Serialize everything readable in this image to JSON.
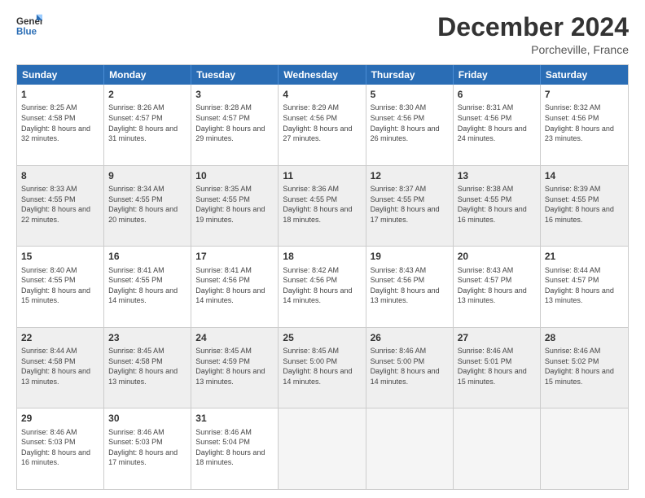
{
  "logo": {
    "line1": "General",
    "line2": "Blue"
  },
  "title": "December 2024",
  "subtitle": "Porcheville, France",
  "header_days": [
    "Sunday",
    "Monday",
    "Tuesday",
    "Wednesday",
    "Thursday",
    "Friday",
    "Saturday"
  ],
  "weeks": [
    {
      "shaded": false,
      "days": [
        {
          "num": "1",
          "sunrise": "Sunrise: 8:25 AM",
          "sunset": "Sunset: 4:58 PM",
          "daylight": "Daylight: 8 hours and 32 minutes."
        },
        {
          "num": "2",
          "sunrise": "Sunrise: 8:26 AM",
          "sunset": "Sunset: 4:57 PM",
          "daylight": "Daylight: 8 hours and 31 minutes."
        },
        {
          "num": "3",
          "sunrise": "Sunrise: 8:28 AM",
          "sunset": "Sunset: 4:57 PM",
          "daylight": "Daylight: 8 hours and 29 minutes."
        },
        {
          "num": "4",
          "sunrise": "Sunrise: 8:29 AM",
          "sunset": "Sunset: 4:56 PM",
          "daylight": "Daylight: 8 hours and 27 minutes."
        },
        {
          "num": "5",
          "sunrise": "Sunrise: 8:30 AM",
          "sunset": "Sunset: 4:56 PM",
          "daylight": "Daylight: 8 hours and 26 minutes."
        },
        {
          "num": "6",
          "sunrise": "Sunrise: 8:31 AM",
          "sunset": "Sunset: 4:56 PM",
          "daylight": "Daylight: 8 hours and 24 minutes."
        },
        {
          "num": "7",
          "sunrise": "Sunrise: 8:32 AM",
          "sunset": "Sunset: 4:56 PM",
          "daylight": "Daylight: 8 hours and 23 minutes."
        }
      ]
    },
    {
      "shaded": true,
      "days": [
        {
          "num": "8",
          "sunrise": "Sunrise: 8:33 AM",
          "sunset": "Sunset: 4:55 PM",
          "daylight": "Daylight: 8 hours and 22 minutes."
        },
        {
          "num": "9",
          "sunrise": "Sunrise: 8:34 AM",
          "sunset": "Sunset: 4:55 PM",
          "daylight": "Daylight: 8 hours and 20 minutes."
        },
        {
          "num": "10",
          "sunrise": "Sunrise: 8:35 AM",
          "sunset": "Sunset: 4:55 PM",
          "daylight": "Daylight: 8 hours and 19 minutes."
        },
        {
          "num": "11",
          "sunrise": "Sunrise: 8:36 AM",
          "sunset": "Sunset: 4:55 PM",
          "daylight": "Daylight: 8 hours and 18 minutes."
        },
        {
          "num": "12",
          "sunrise": "Sunrise: 8:37 AM",
          "sunset": "Sunset: 4:55 PM",
          "daylight": "Daylight: 8 hours and 17 minutes."
        },
        {
          "num": "13",
          "sunrise": "Sunrise: 8:38 AM",
          "sunset": "Sunset: 4:55 PM",
          "daylight": "Daylight: 8 hours and 16 minutes."
        },
        {
          "num": "14",
          "sunrise": "Sunrise: 8:39 AM",
          "sunset": "Sunset: 4:55 PM",
          "daylight": "Daylight: 8 hours and 16 minutes."
        }
      ]
    },
    {
      "shaded": false,
      "days": [
        {
          "num": "15",
          "sunrise": "Sunrise: 8:40 AM",
          "sunset": "Sunset: 4:55 PM",
          "daylight": "Daylight: 8 hours and 15 minutes."
        },
        {
          "num": "16",
          "sunrise": "Sunrise: 8:41 AM",
          "sunset": "Sunset: 4:55 PM",
          "daylight": "Daylight: 8 hours and 14 minutes."
        },
        {
          "num": "17",
          "sunrise": "Sunrise: 8:41 AM",
          "sunset": "Sunset: 4:56 PM",
          "daylight": "Daylight: 8 hours and 14 minutes."
        },
        {
          "num": "18",
          "sunrise": "Sunrise: 8:42 AM",
          "sunset": "Sunset: 4:56 PM",
          "daylight": "Daylight: 8 hours and 14 minutes."
        },
        {
          "num": "19",
          "sunrise": "Sunrise: 8:43 AM",
          "sunset": "Sunset: 4:56 PM",
          "daylight": "Daylight: 8 hours and 13 minutes."
        },
        {
          "num": "20",
          "sunrise": "Sunrise: 8:43 AM",
          "sunset": "Sunset: 4:57 PM",
          "daylight": "Daylight: 8 hours and 13 minutes."
        },
        {
          "num": "21",
          "sunrise": "Sunrise: 8:44 AM",
          "sunset": "Sunset: 4:57 PM",
          "daylight": "Daylight: 8 hours and 13 minutes."
        }
      ]
    },
    {
      "shaded": true,
      "days": [
        {
          "num": "22",
          "sunrise": "Sunrise: 8:44 AM",
          "sunset": "Sunset: 4:58 PM",
          "daylight": "Daylight: 8 hours and 13 minutes."
        },
        {
          "num": "23",
          "sunrise": "Sunrise: 8:45 AM",
          "sunset": "Sunset: 4:58 PM",
          "daylight": "Daylight: 8 hours and 13 minutes."
        },
        {
          "num": "24",
          "sunrise": "Sunrise: 8:45 AM",
          "sunset": "Sunset: 4:59 PM",
          "daylight": "Daylight: 8 hours and 13 minutes."
        },
        {
          "num": "25",
          "sunrise": "Sunrise: 8:45 AM",
          "sunset": "Sunset: 5:00 PM",
          "daylight": "Daylight: 8 hours and 14 minutes."
        },
        {
          "num": "26",
          "sunrise": "Sunrise: 8:46 AM",
          "sunset": "Sunset: 5:00 PM",
          "daylight": "Daylight: 8 hours and 14 minutes."
        },
        {
          "num": "27",
          "sunrise": "Sunrise: 8:46 AM",
          "sunset": "Sunset: 5:01 PM",
          "daylight": "Daylight: 8 hours and 15 minutes."
        },
        {
          "num": "28",
          "sunrise": "Sunrise: 8:46 AM",
          "sunset": "Sunset: 5:02 PM",
          "daylight": "Daylight: 8 hours and 15 minutes."
        }
      ]
    },
    {
      "shaded": false,
      "days": [
        {
          "num": "29",
          "sunrise": "Sunrise: 8:46 AM",
          "sunset": "Sunset: 5:03 PM",
          "daylight": "Daylight: 8 hours and 16 minutes."
        },
        {
          "num": "30",
          "sunrise": "Sunrise: 8:46 AM",
          "sunset": "Sunset: 5:03 PM",
          "daylight": "Daylight: 8 hours and 17 minutes."
        },
        {
          "num": "31",
          "sunrise": "Sunrise: 8:46 AM",
          "sunset": "Sunset: 5:04 PM",
          "daylight": "Daylight: 8 hours and 18 minutes."
        },
        null,
        null,
        null,
        null
      ]
    }
  ]
}
